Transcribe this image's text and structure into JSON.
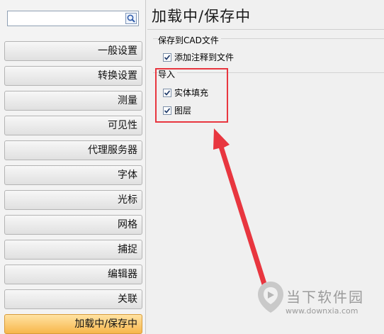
{
  "sidebar": {
    "search": {
      "value": "",
      "placeholder": ""
    },
    "items": [
      {
        "label": "一般设置",
        "active": false
      },
      {
        "label": "转换设置",
        "active": false
      },
      {
        "label": "测量",
        "active": false
      },
      {
        "label": "可见性",
        "active": false
      },
      {
        "label": "代理服务器",
        "active": false
      },
      {
        "label": "字体",
        "active": false
      },
      {
        "label": "光标",
        "active": false
      },
      {
        "label": "网格",
        "active": false
      },
      {
        "label": "捕捉",
        "active": false
      },
      {
        "label": "编辑器",
        "active": false
      },
      {
        "label": "关联",
        "active": false
      },
      {
        "label": "加载中/保存中",
        "active": true
      }
    ]
  },
  "panel": {
    "title": "加载中/保存中",
    "groups": [
      {
        "label": "保存到CAD文件",
        "options": [
          {
            "label": "添加注释到文件",
            "checked": true
          }
        ]
      },
      {
        "label": "导入",
        "options": [
          {
            "label": "实体填充",
            "checked": true
          },
          {
            "label": "图层",
            "checked": true
          }
        ]
      }
    ]
  },
  "annotation": {
    "highlight_color": "#e8363f"
  },
  "watermark": {
    "brand": "当下软件园",
    "url": "www.downxia.com"
  },
  "icons": {
    "search": "magnifier-icon",
    "check": "checkmark-icon"
  }
}
